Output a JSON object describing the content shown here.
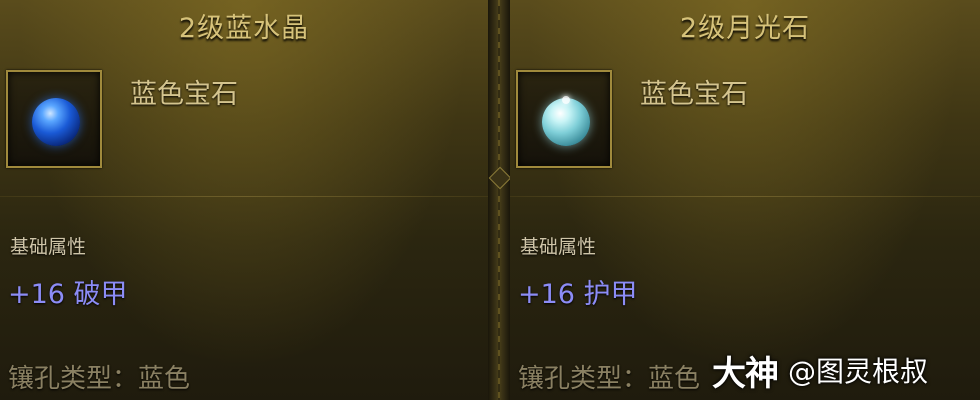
{
  "items": [
    {
      "title": "2级蓝水晶",
      "gem_type": "蓝色宝石",
      "gem_icon": "blue-crystal-gem-icon",
      "attr_heading": "基础属性",
      "attr_value": "+16 破甲",
      "socket_type": "镶孔类型：蓝色"
    },
    {
      "title": "2级月光石",
      "gem_type": "蓝色宝石",
      "gem_icon": "moonstone-gem-icon",
      "attr_heading": "基础属性",
      "attr_value": "+16 护甲",
      "socket_type": "镶孔类型：蓝色"
    }
  ],
  "watermark": {
    "logo": "大神",
    "handle": "@图灵根叔"
  },
  "colors": {
    "title": "#d6c27a",
    "attr_value": "#8c8cf6",
    "frame": "#a08a3c"
  }
}
